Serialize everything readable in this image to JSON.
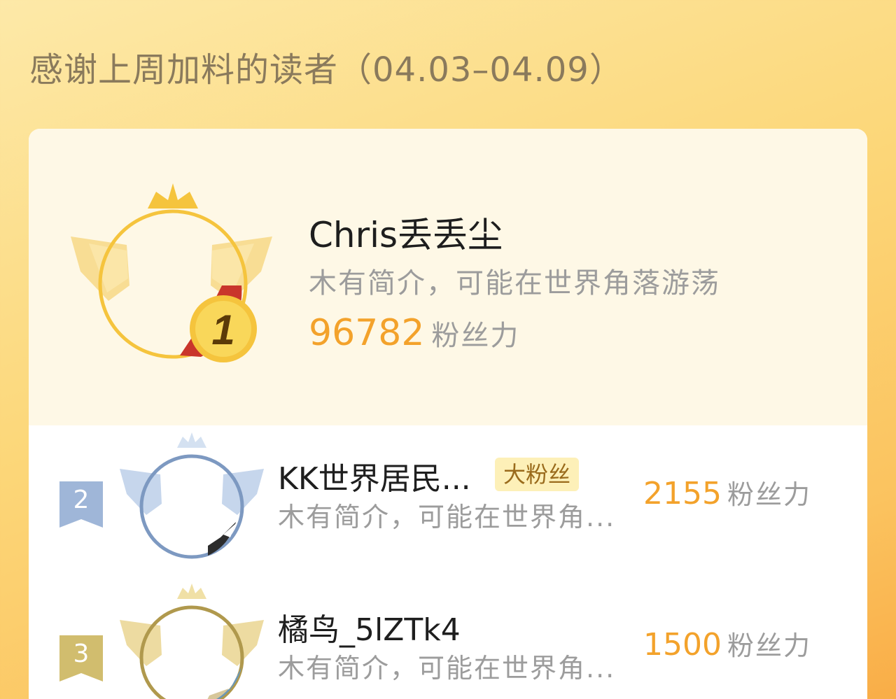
{
  "header": {
    "title": "感谢上周加料的读者（04.03–04.09）"
  },
  "colors": {
    "accent_orange": "#f3a22b",
    "gold": "#f5c43d",
    "silver_blue": "#7d99c1",
    "bronze": "#b0994d",
    "text_gray": "#9c9c9c"
  },
  "readers": [
    {
      "rank": "1",
      "name": "Chris丢丢尘",
      "bio": "木有简介，可能在世界角落游荡",
      "score": "96782",
      "score_unit": "粉丝力",
      "avatar_frame_icon": "gold-crown-wings-frame-icon"
    },
    {
      "rank": "2",
      "name": "KK世界居民...",
      "badge": "大粉丝",
      "bio": "木有简介，可能在世界角...",
      "score": "2155",
      "score_unit": "粉丝力",
      "avatar_frame_icon": "silver-crown-wings-frame-icon"
    },
    {
      "rank": "3",
      "name": "橘鸟_5lZTk4",
      "bio": "木有简介，可能在世界角...",
      "score": "1500",
      "score_unit": "粉丝力",
      "avatar_frame_icon": "bronze-crown-wings-frame-icon"
    }
  ]
}
